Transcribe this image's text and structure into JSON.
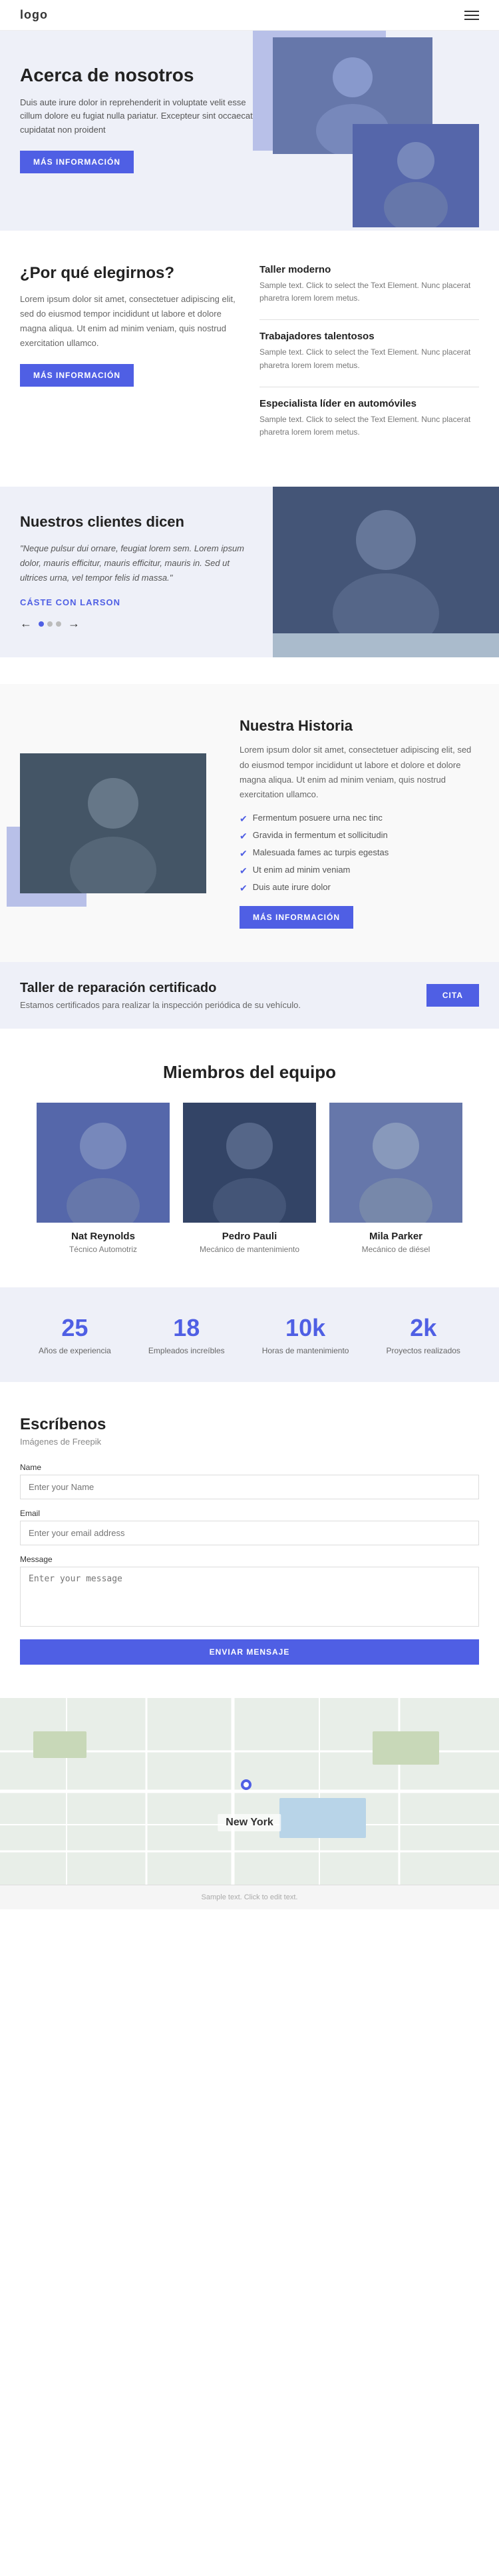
{
  "header": {
    "logo": "logo",
    "menu_icon": "☰"
  },
  "hero": {
    "title": "Acerca de nosotros",
    "text": "Duis aute irure dolor in reprehenderit in voluptate velit esse cillum dolore eu fugiat nulla pariatur. Excepteur sint occaecat cupidatat non proident",
    "btn": "MÁS INFORMACIÓN"
  },
  "why": {
    "title": "¿Por qué elegirnos?",
    "text": "Lorem ipsum dolor sit amet, consectetuer adipiscing elit, sed do eiusmod tempor incididunt ut labore et dolore magna aliqua. Ut enim ad minim veniam, quis nostrud exercitation ullamco.",
    "btn": "MÁS INFORMACIÓN",
    "features": [
      {
        "title": "Taller moderno",
        "text": "Sample text. Click to select the Text Element. Nunc placerat pharetra lorem lorem metus."
      },
      {
        "title": "Trabajadores talentosos",
        "text": "Sample text. Click to select the Text Element. Nunc placerat pharetra lorem lorem metus."
      },
      {
        "title": "Especialista líder en automóviles",
        "text": "Sample text. Click to select the Text Element. Nunc placerat pharetra lorem lorem metus."
      }
    ]
  },
  "testimonials": {
    "title": "Nuestros clientes dicen",
    "quote": "\"Neque pulsur dui ornare, feugiat lorem sem. Lorem ipsum dolor, mauris efficitur, mauris efficitur, mauris in. Sed ut ultrices urna, vel tempor felis id massa.\"",
    "author": "CÁSTE CON LARSON",
    "dots": [
      true,
      false,
      false
    ]
  },
  "story": {
    "title": "Nuestra Historia",
    "text": "Lorem ipsum dolor sit amet, consectetuer adipiscing elit, sed do eiusmod tempor incididunt ut labore et dolore et dolore magna aliqua. Ut enim ad minim veniam, quis nostrud exercitation ullamco.",
    "btn": "MÁS INFORMACIÓN",
    "checklist": [
      "Fermentum posuere urna nec tinc",
      "Gravida in fermentum et sollicitudin",
      "Malesuada fames ac turpis egestas",
      "Ut enim ad minim veniam",
      "Duis aute irure dolor"
    ]
  },
  "cta": {
    "title": "Taller de reparación certificado",
    "text": "Estamos certificados para realizar la inspección periódica de su vehículo.",
    "btn": "CITA"
  },
  "team": {
    "title": "Miembros del equipo",
    "members": [
      {
        "name": "Nat Reynolds",
        "role": "Técnico Automotriz"
      },
      {
        "name": "Pedro Pauli",
        "role": "Mecánico de mantenimiento"
      },
      {
        "name": "Mila Parker",
        "role": "Mecánico de diésel"
      }
    ]
  },
  "stats": [
    {
      "number": "25",
      "label": "Años de experiencia"
    },
    {
      "number": "18",
      "label": "Empleados increíbles"
    },
    {
      "number": "10k",
      "label": "Horas de mantenimiento"
    },
    {
      "number": "2k",
      "label": "Proyectos realizados"
    }
  ],
  "contact": {
    "title": "Escríbenos",
    "subtitle": "Imágenes de Freepik",
    "fields": [
      {
        "label": "Name",
        "placeholder": "Enter your Name",
        "type": "text"
      },
      {
        "label": "Email",
        "placeholder": "Enter your email address",
        "type": "email"
      },
      {
        "label": "Message",
        "placeholder": "Enter your message",
        "type": "textarea"
      }
    ],
    "btn": "ENVIAR MENSAJE"
  },
  "map": {
    "city": "New York"
  },
  "footer": {
    "text": "Sample text. Click to edit text."
  }
}
